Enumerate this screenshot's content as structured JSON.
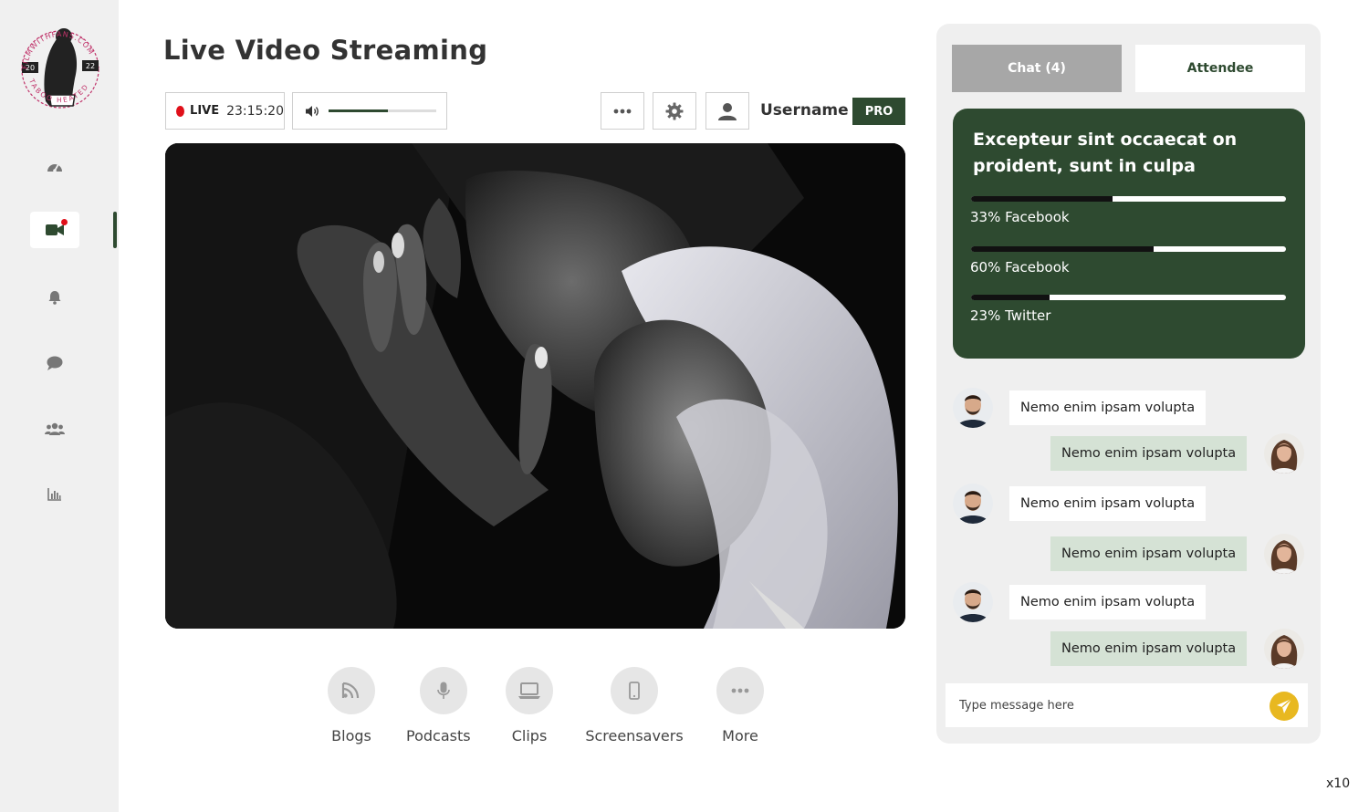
{
  "brand": {
    "logo_text": "FILMWITHFANS.COM",
    "logo_sub": "TABOO HEATED",
    "logo_year_left": "20",
    "logo_year_right": "22"
  },
  "sidebar": {
    "items": [
      {
        "icon": "dashboard-icon",
        "active": false
      },
      {
        "icon": "video-camera-icon",
        "active": true,
        "notification": true
      },
      {
        "icon": "bell-icon",
        "active": false
      },
      {
        "icon": "chat-bubble-icon",
        "active": false
      },
      {
        "icon": "users-icon",
        "active": false
      },
      {
        "icon": "bar-chart-icon",
        "active": false
      }
    ]
  },
  "page": {
    "title": "Live Video Streaming"
  },
  "toolbar": {
    "live_label": "LIVE",
    "live_time": "23:15:20",
    "volume_level": 0.55,
    "more_icon": "ellipsis-icon",
    "settings_icon": "gear-icon",
    "profile_icon": "user-icon",
    "username": "Username",
    "badge": "PRO"
  },
  "actions": [
    {
      "label": "Blogs",
      "icon": "blog-icon"
    },
    {
      "label": "Podcasts",
      "icon": "microphone-icon"
    },
    {
      "label": "Clips",
      "icon": "laptop-icon"
    },
    {
      "label": "Screensavers",
      "icon": "phone-icon"
    },
    {
      "label": "More",
      "icon": "ellipsis-icon"
    }
  ],
  "panel": {
    "tabs": [
      {
        "label": "Chat (4)",
        "active": true
      },
      {
        "label": "Attendee",
        "active": false
      }
    ],
    "poll": {
      "question": "Excepteur sint occaecat on proident, sunt in culpa",
      "options": [
        {
          "label": "33% Facebook",
          "percent": 45
        },
        {
          "label": "60% Facebook",
          "percent": 58
        },
        {
          "label": "23% Twitter",
          "percent": 25
        }
      ]
    },
    "messages": [
      {
        "side": "in",
        "text": "Nemo enim ipsam volupta"
      },
      {
        "side": "out",
        "text": "Nemo enim ipsam volupta"
      },
      {
        "side": "in",
        "text": "Nemo enim ipsam volupta"
      },
      {
        "side": "out",
        "text": "Nemo enim ipsam volupta"
      },
      {
        "side": "in",
        "text": "Nemo enim ipsam volupta"
      },
      {
        "side": "out",
        "text": "Nemo enim ipsam volupta"
      }
    ],
    "input_placeholder": "Type message here",
    "send_icon": "paper-plane-icon"
  },
  "zoom": "x10",
  "colors": {
    "accent": "#2e4a30",
    "live": "#e0101a",
    "send": "#e8b820",
    "bubble_out": "#d5e2d5"
  }
}
